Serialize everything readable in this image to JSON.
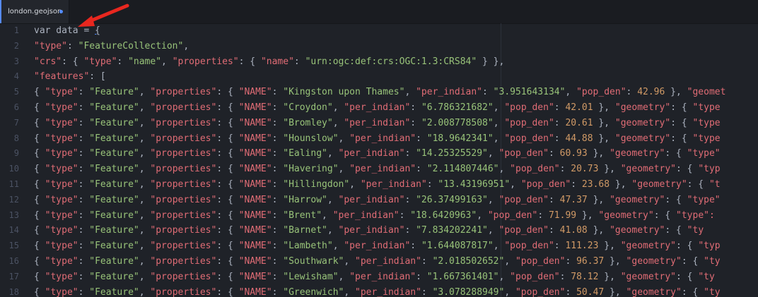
{
  "tab": {
    "title": "london.geojson"
  },
  "colors": {
    "background": "#1f2228",
    "string_key": "#e06c75",
    "string_value": "#98c379",
    "number": "#d19a66",
    "line_number": "#4b5263",
    "arrow": "#e8271f"
  },
  "lines": [
    {
      "num": "1",
      "segments": [
        [
          "k",
          "var data = "
        ],
        [
          "b",
          "{"
        ]
      ]
    },
    {
      "num": "2",
      "segments": [
        [
          "sr",
          "\"type\""
        ],
        [
          "p",
          ": "
        ],
        [
          "s",
          "\"FeatureCollection\""
        ],
        [
          "p",
          ","
        ]
      ]
    },
    {
      "num": "3",
      "segments": [
        [
          "sr",
          "\"crs\""
        ],
        [
          "p",
          ": { "
        ],
        [
          "sr",
          "\"type\""
        ],
        [
          "p",
          ": "
        ],
        [
          "s",
          "\"name\""
        ],
        [
          "p",
          ", "
        ],
        [
          "sr",
          "\"properties\""
        ],
        [
          "p",
          ": { "
        ],
        [
          "sr",
          "\"name\""
        ],
        [
          "p",
          ": "
        ],
        [
          "s",
          "\"urn:ogc:def:crs:OGC:1.3:CRS84\""
        ],
        [
          "p",
          " } },"
        ]
      ]
    },
    {
      "num": "4",
      "segments": [
        [
          "sr",
          "\"features\""
        ],
        [
          "p",
          ": ["
        ]
      ]
    },
    {
      "num": "5",
      "segments": [
        [
          "p",
          "{ "
        ],
        [
          "sr",
          "\"type\""
        ],
        [
          "p",
          ": "
        ],
        [
          "s",
          "\"Feature\""
        ],
        [
          "p",
          ", "
        ],
        [
          "sr",
          "\"properties\""
        ],
        [
          "p",
          ": { "
        ],
        [
          "sr",
          "\"NAME\""
        ],
        [
          "p",
          ": "
        ],
        [
          "s",
          "\"Kingston upon Thames\""
        ],
        [
          "p",
          ", "
        ],
        [
          "sr",
          "\"per_indian\""
        ],
        [
          "p",
          ": "
        ],
        [
          "s",
          "\"3.951643134\""
        ],
        [
          "p",
          ", "
        ],
        [
          "sr",
          "\"pop_den\""
        ],
        [
          "p",
          ": "
        ],
        [
          "n",
          "42.96"
        ],
        [
          "p",
          " }, "
        ],
        [
          "sr",
          "\"geomet"
        ]
      ]
    },
    {
      "num": "6",
      "segments": [
        [
          "p",
          "{ "
        ],
        [
          "sr",
          "\"type\""
        ],
        [
          "p",
          ": "
        ],
        [
          "s",
          "\"Feature\""
        ],
        [
          "p",
          ", "
        ],
        [
          "sr",
          "\"properties\""
        ],
        [
          "p",
          ": { "
        ],
        [
          "sr",
          "\"NAME\""
        ],
        [
          "p",
          ": "
        ],
        [
          "s",
          "\"Croydon\""
        ],
        [
          "p",
          ", "
        ],
        [
          "sr",
          "\"per_indian\""
        ],
        [
          "p",
          ": "
        ],
        [
          "s",
          "\"6.786321682\""
        ],
        [
          "p",
          ", "
        ],
        [
          "sr",
          "\"pop_den\""
        ],
        [
          "p",
          ": "
        ],
        [
          "n",
          "42.01"
        ],
        [
          "p",
          " }, "
        ],
        [
          "sr",
          "\"geometry\""
        ],
        [
          "p",
          ": { "
        ],
        [
          "sr",
          "\"type"
        ]
      ]
    },
    {
      "num": "7",
      "segments": [
        [
          "p",
          "{ "
        ],
        [
          "sr",
          "\"type\""
        ],
        [
          "p",
          ": "
        ],
        [
          "s",
          "\"Feature\""
        ],
        [
          "p",
          ", "
        ],
        [
          "sr",
          "\"properties\""
        ],
        [
          "p",
          ": { "
        ],
        [
          "sr",
          "\"NAME\""
        ],
        [
          "p",
          ": "
        ],
        [
          "s",
          "\"Bromley\""
        ],
        [
          "p",
          ", "
        ],
        [
          "sr",
          "\"per_indian\""
        ],
        [
          "p",
          ": "
        ],
        [
          "s",
          "\"2.008778508\""
        ],
        [
          "p",
          ", "
        ],
        [
          "sr",
          "\"pop_den\""
        ],
        [
          "p",
          ": "
        ],
        [
          "n",
          "20.61"
        ],
        [
          "p",
          " }, "
        ],
        [
          "sr",
          "\"geometry\""
        ],
        [
          "p",
          ": { "
        ],
        [
          "sr",
          "\"type"
        ]
      ]
    },
    {
      "num": "8",
      "segments": [
        [
          "p",
          "{ "
        ],
        [
          "sr",
          "\"type\""
        ],
        [
          "p",
          ": "
        ],
        [
          "s",
          "\"Feature\""
        ],
        [
          "p",
          ", "
        ],
        [
          "sr",
          "\"properties\""
        ],
        [
          "p",
          ": { "
        ],
        [
          "sr",
          "\"NAME\""
        ],
        [
          "p",
          ": "
        ],
        [
          "s",
          "\"Hounslow\""
        ],
        [
          "p",
          ", "
        ],
        [
          "sr",
          "\"per_indian\""
        ],
        [
          "p",
          ": "
        ],
        [
          "s",
          "\"18.9642341\""
        ],
        [
          "p",
          ", "
        ],
        [
          "sr",
          "\"pop_den\""
        ],
        [
          "p",
          ": "
        ],
        [
          "n",
          "44.88"
        ],
        [
          "p",
          " }, "
        ],
        [
          "sr",
          "\"geometry\""
        ],
        [
          "p",
          ": { "
        ],
        [
          "sr",
          "\"type"
        ]
      ]
    },
    {
      "num": "9",
      "segments": [
        [
          "p",
          "{ "
        ],
        [
          "sr",
          "\"type\""
        ],
        [
          "p",
          ": "
        ],
        [
          "s",
          "\"Feature\""
        ],
        [
          "p",
          ", "
        ],
        [
          "sr",
          "\"properties\""
        ],
        [
          "p",
          ": { "
        ],
        [
          "sr",
          "\"NAME\""
        ],
        [
          "p",
          ": "
        ],
        [
          "s",
          "\"Ealing\""
        ],
        [
          "p",
          ", "
        ],
        [
          "sr",
          "\"per_indian\""
        ],
        [
          "p",
          ": "
        ],
        [
          "s",
          "\"14.25325529\""
        ],
        [
          "p",
          ", "
        ],
        [
          "sr",
          "\"pop_den\""
        ],
        [
          "p",
          ": "
        ],
        [
          "n",
          "60.93"
        ],
        [
          "p",
          " }, "
        ],
        [
          "sr",
          "\"geometry\""
        ],
        [
          "p",
          ": { "
        ],
        [
          "sr",
          "\"type\""
        ]
      ]
    },
    {
      "num": "10",
      "segments": [
        [
          "p",
          "{ "
        ],
        [
          "sr",
          "\"type\""
        ],
        [
          "p",
          ": "
        ],
        [
          "s",
          "\"Feature\""
        ],
        [
          "p",
          ", "
        ],
        [
          "sr",
          "\"properties\""
        ],
        [
          "p",
          ": { "
        ],
        [
          "sr",
          "\"NAME\""
        ],
        [
          "p",
          ": "
        ],
        [
          "s",
          "\"Havering\""
        ],
        [
          "p",
          ", "
        ],
        [
          "sr",
          "\"per_indian\""
        ],
        [
          "p",
          ": "
        ],
        [
          "s",
          "\"2.114807446\""
        ],
        [
          "p",
          ", "
        ],
        [
          "sr",
          "\"pop_den\""
        ],
        [
          "p",
          ": "
        ],
        [
          "n",
          "20.73"
        ],
        [
          "p",
          " }, "
        ],
        [
          "sr",
          "\"geometry\""
        ],
        [
          "p",
          ": { "
        ],
        [
          "sr",
          "\"typ"
        ]
      ]
    },
    {
      "num": "11",
      "segments": [
        [
          "p",
          "{ "
        ],
        [
          "sr",
          "\"type\""
        ],
        [
          "p",
          ": "
        ],
        [
          "s",
          "\"Feature\""
        ],
        [
          "p",
          ", "
        ],
        [
          "sr",
          "\"properties\""
        ],
        [
          "p",
          ": { "
        ],
        [
          "sr",
          "\"NAME\""
        ],
        [
          "p",
          ": "
        ],
        [
          "s",
          "\"Hillingdon\""
        ],
        [
          "p",
          ", "
        ],
        [
          "sr",
          "\"per_indian\""
        ],
        [
          "p",
          ": "
        ],
        [
          "s",
          "\"13.43196951\""
        ],
        [
          "p",
          ", "
        ],
        [
          "sr",
          "\"pop_den\""
        ],
        [
          "p",
          ": "
        ],
        [
          "n",
          "23.68"
        ],
        [
          "p",
          " }, "
        ],
        [
          "sr",
          "\"geometry\""
        ],
        [
          "p",
          ": { "
        ],
        [
          "sr",
          "\"t"
        ]
      ]
    },
    {
      "num": "12",
      "segments": [
        [
          "p",
          "{ "
        ],
        [
          "sr",
          "\"type\""
        ],
        [
          "p",
          ": "
        ],
        [
          "s",
          "\"Feature\""
        ],
        [
          "p",
          ", "
        ],
        [
          "sr",
          "\"properties\""
        ],
        [
          "p",
          ": { "
        ],
        [
          "sr",
          "\"NAME\""
        ],
        [
          "p",
          ": "
        ],
        [
          "s",
          "\"Harrow\""
        ],
        [
          "p",
          ", "
        ],
        [
          "sr",
          "\"per_indian\""
        ],
        [
          "p",
          ": "
        ],
        [
          "s",
          "\"26.37499163\""
        ],
        [
          "p",
          ", "
        ],
        [
          "sr",
          "\"pop_den\""
        ],
        [
          "p",
          ": "
        ],
        [
          "n",
          "47.37"
        ],
        [
          "p",
          " }, "
        ],
        [
          "sr",
          "\"geometry\""
        ],
        [
          "p",
          ": { "
        ],
        [
          "sr",
          "\"type\""
        ]
      ]
    },
    {
      "num": "13",
      "segments": [
        [
          "p",
          "{ "
        ],
        [
          "sr",
          "\"type\""
        ],
        [
          "p",
          ": "
        ],
        [
          "s",
          "\"Feature\""
        ],
        [
          "p",
          ", "
        ],
        [
          "sr",
          "\"properties\""
        ],
        [
          "p",
          ": { "
        ],
        [
          "sr",
          "\"NAME\""
        ],
        [
          "p",
          ": "
        ],
        [
          "s",
          "\"Brent\""
        ],
        [
          "p",
          ", "
        ],
        [
          "sr",
          "\"per_indian\""
        ],
        [
          "p",
          ": "
        ],
        [
          "s",
          "\"18.6420963\""
        ],
        [
          "p",
          ", "
        ],
        [
          "sr",
          "\"pop_den\""
        ],
        [
          "p",
          ": "
        ],
        [
          "n",
          "71.99"
        ],
        [
          "p",
          " }, "
        ],
        [
          "sr",
          "\"geometry\""
        ],
        [
          "p",
          ": { "
        ],
        [
          "sr",
          "\"type\":"
        ]
      ]
    },
    {
      "num": "14",
      "segments": [
        [
          "p",
          "{ "
        ],
        [
          "sr",
          "\"type\""
        ],
        [
          "p",
          ": "
        ],
        [
          "s",
          "\"Feature\""
        ],
        [
          "p",
          ", "
        ],
        [
          "sr",
          "\"properties\""
        ],
        [
          "p",
          ": { "
        ],
        [
          "sr",
          "\"NAME\""
        ],
        [
          "p",
          ": "
        ],
        [
          "s",
          "\"Barnet\""
        ],
        [
          "p",
          ", "
        ],
        [
          "sr",
          "\"per_indian\""
        ],
        [
          "p",
          ": "
        ],
        [
          "s",
          "\"7.834202241\""
        ],
        [
          "p",
          ", "
        ],
        [
          "sr",
          "\"pop_den\""
        ],
        [
          "p",
          ": "
        ],
        [
          "n",
          "41.08"
        ],
        [
          "p",
          " }, "
        ],
        [
          "sr",
          "\"geometry\""
        ],
        [
          "p",
          ": { "
        ],
        [
          "sr",
          "\"ty"
        ]
      ]
    },
    {
      "num": "15",
      "segments": [
        [
          "p",
          "{ "
        ],
        [
          "sr",
          "\"type\""
        ],
        [
          "p",
          ": "
        ],
        [
          "s",
          "\"Feature\""
        ],
        [
          "p",
          ", "
        ],
        [
          "sr",
          "\"properties\""
        ],
        [
          "p",
          ": { "
        ],
        [
          "sr",
          "\"NAME\""
        ],
        [
          "p",
          ": "
        ],
        [
          "s",
          "\"Lambeth\""
        ],
        [
          "p",
          ", "
        ],
        [
          "sr",
          "\"per_indian\""
        ],
        [
          "p",
          ": "
        ],
        [
          "s",
          "\"1.644087817\""
        ],
        [
          "p",
          ", "
        ],
        [
          "sr",
          "\"pop_den\""
        ],
        [
          "p",
          ": "
        ],
        [
          "n",
          "111.23"
        ],
        [
          "p",
          " }, "
        ],
        [
          "sr",
          "\"geometry\""
        ],
        [
          "p",
          ": { "
        ],
        [
          "sr",
          "\"typ"
        ]
      ]
    },
    {
      "num": "16",
      "segments": [
        [
          "p",
          "{ "
        ],
        [
          "sr",
          "\"type\""
        ],
        [
          "p",
          ": "
        ],
        [
          "s",
          "\"Feature\""
        ],
        [
          "p",
          ", "
        ],
        [
          "sr",
          "\"properties\""
        ],
        [
          "p",
          ": { "
        ],
        [
          "sr",
          "\"NAME\""
        ],
        [
          "p",
          ": "
        ],
        [
          "s",
          "\"Southwark\""
        ],
        [
          "p",
          ", "
        ],
        [
          "sr",
          "\"per_indian\""
        ],
        [
          "p",
          ": "
        ],
        [
          "s",
          "\"2.018502652\""
        ],
        [
          "p",
          ", "
        ],
        [
          "sr",
          "\"pop_den\""
        ],
        [
          "p",
          ": "
        ],
        [
          "n",
          "96.37"
        ],
        [
          "p",
          " }, "
        ],
        [
          "sr",
          "\"geometry\""
        ],
        [
          "p",
          ": { "
        ],
        [
          "sr",
          "\"ty"
        ]
      ]
    },
    {
      "num": "17",
      "segments": [
        [
          "p",
          "{ "
        ],
        [
          "sr",
          "\"type\""
        ],
        [
          "p",
          ": "
        ],
        [
          "s",
          "\"Feature\""
        ],
        [
          "p",
          ", "
        ],
        [
          "sr",
          "\"properties\""
        ],
        [
          "p",
          ": { "
        ],
        [
          "sr",
          "\"NAME\""
        ],
        [
          "p",
          ": "
        ],
        [
          "s",
          "\"Lewisham\""
        ],
        [
          "p",
          ", "
        ],
        [
          "sr",
          "\"per_indian\""
        ],
        [
          "p",
          ": "
        ],
        [
          "s",
          "\"1.667361401\""
        ],
        [
          "p",
          ", "
        ],
        [
          "sr",
          "\"pop_den\""
        ],
        [
          "p",
          ": "
        ],
        [
          "n",
          "78.12"
        ],
        [
          "p",
          " }, "
        ],
        [
          "sr",
          "\"geometry\""
        ],
        [
          "p",
          ": { "
        ],
        [
          "sr",
          "\"ty"
        ]
      ]
    },
    {
      "num": "18",
      "segments": [
        [
          "p",
          "{ "
        ],
        [
          "sr",
          "\"type\""
        ],
        [
          "p",
          ": "
        ],
        [
          "s",
          "\"Feature\""
        ],
        [
          "p",
          ", "
        ],
        [
          "sr",
          "\"properties\""
        ],
        [
          "p",
          ": { "
        ],
        [
          "sr",
          "\"NAME\""
        ],
        [
          "p",
          ": "
        ],
        [
          "s",
          "\"Greenwich\""
        ],
        [
          "p",
          ", "
        ],
        [
          "sr",
          "\"per_indian\""
        ],
        [
          "p",
          ": "
        ],
        [
          "s",
          "\"3.078288949\""
        ],
        [
          "p",
          ", "
        ],
        [
          "sr",
          "\"pop_den\""
        ],
        [
          "p",
          ": "
        ],
        [
          "n",
          "50.47"
        ],
        [
          "p",
          " }, "
        ],
        [
          "sr",
          "\"geometry\""
        ],
        [
          "p",
          ": { "
        ],
        [
          "sr",
          "\"ty"
        ]
      ]
    }
  ]
}
